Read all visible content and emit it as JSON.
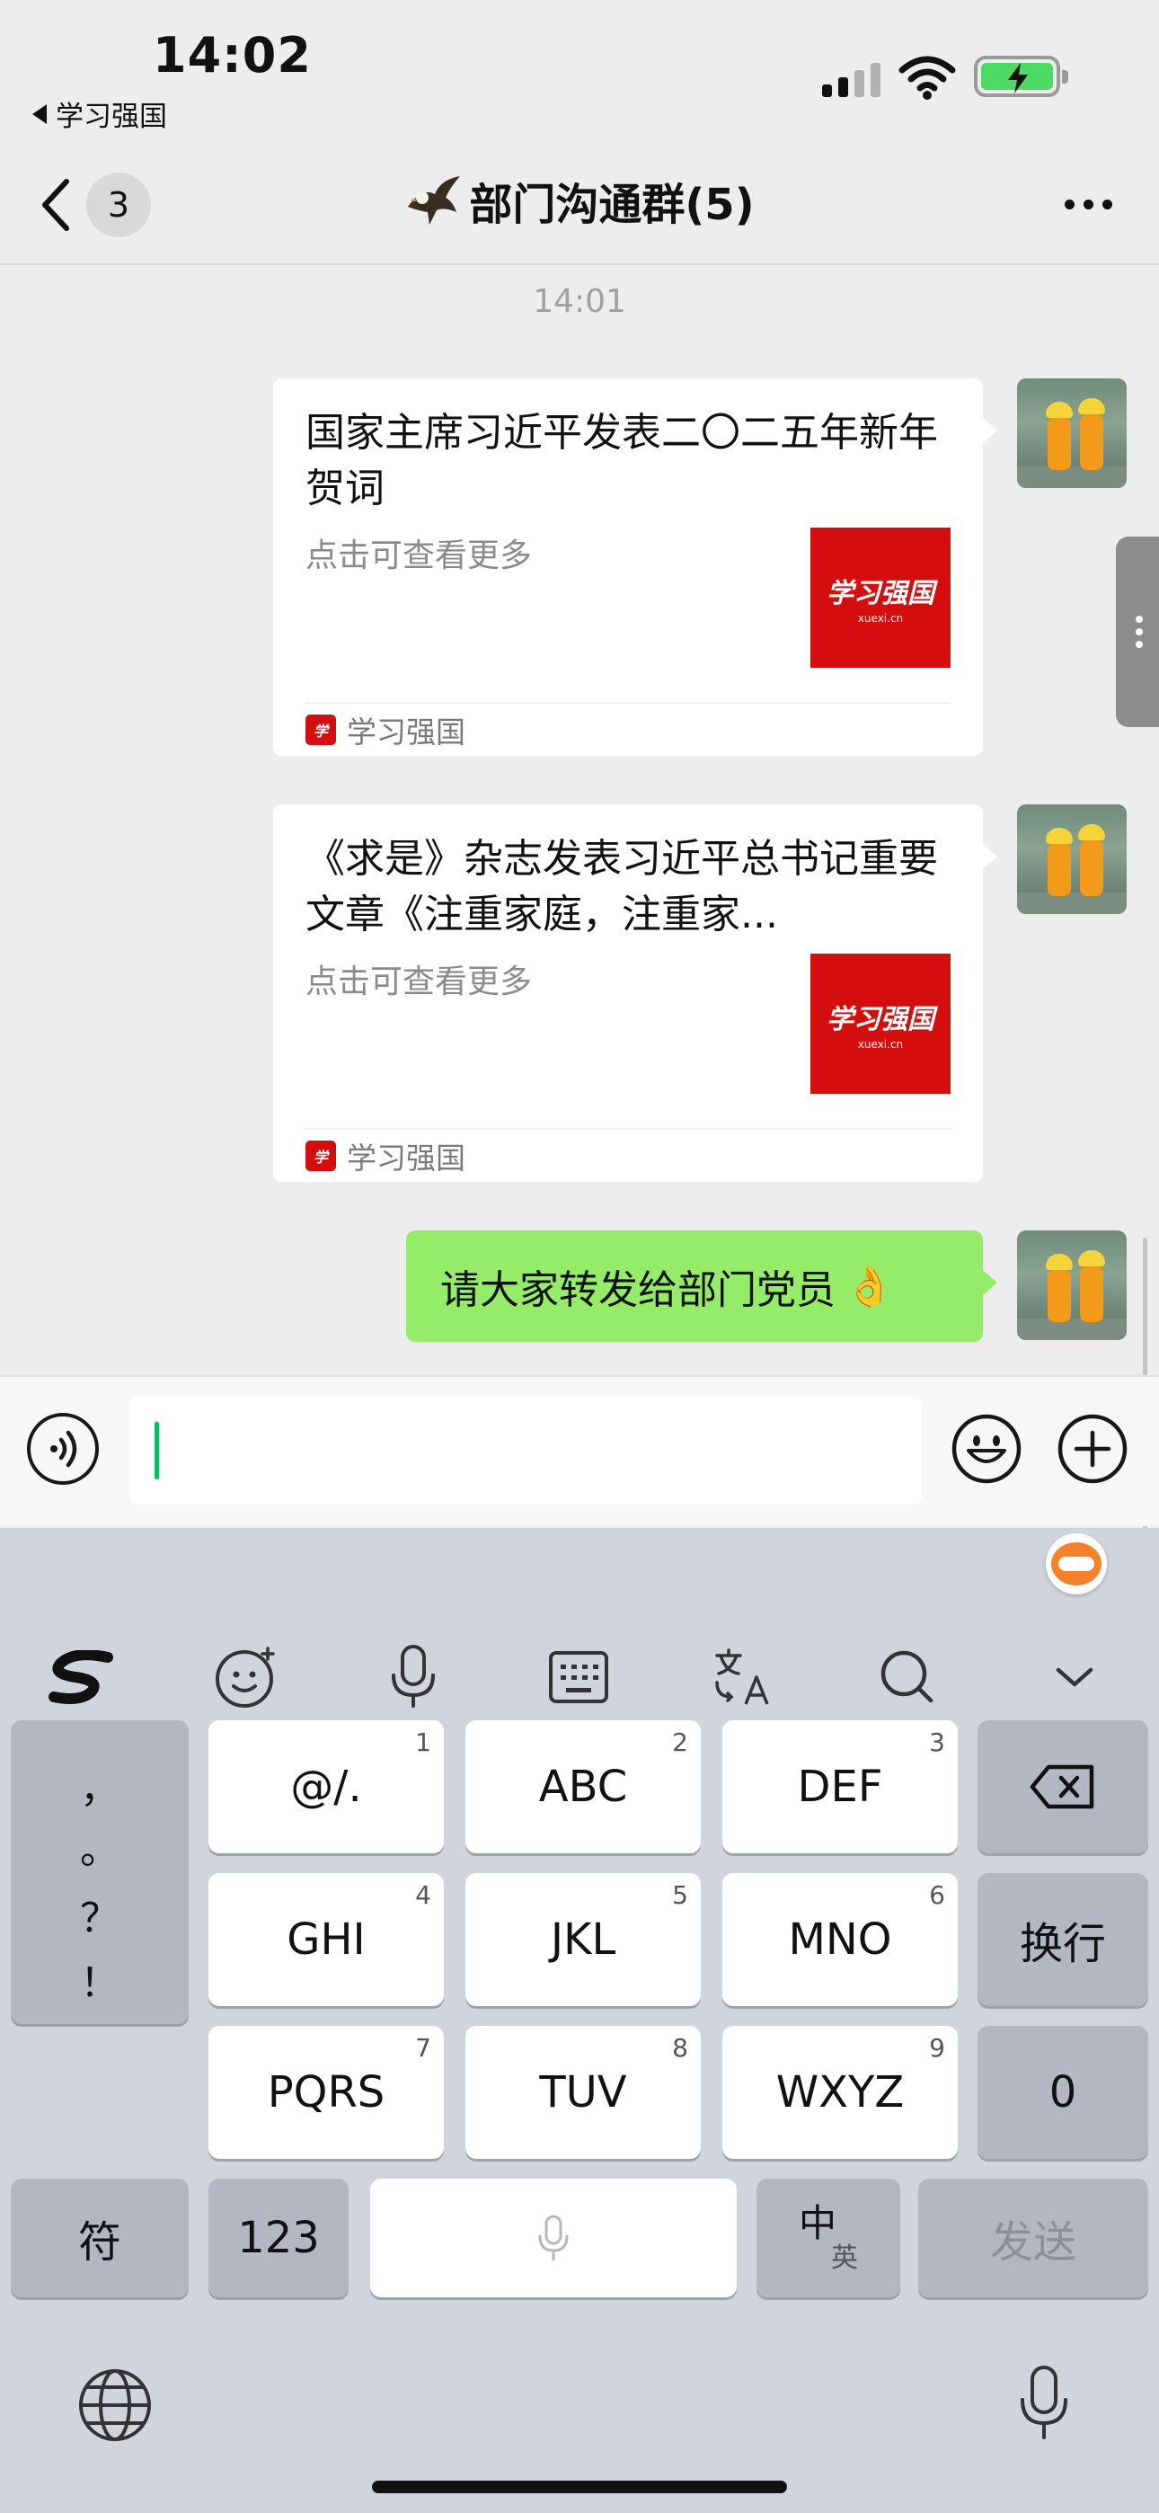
{
  "status_bar": {
    "time": "14:02",
    "back_app": "学习强国"
  },
  "nav": {
    "unread_count": "3",
    "title": "部门沟通群(5)"
  },
  "chat": {
    "timestamp": "14:01",
    "messages": [
      {
        "type": "link_card",
        "title": "国家主席习近平发表二〇二五年新年贺词",
        "description": "点击可查看更多",
        "source": "学习强国",
        "thumb_logo": "学习强国",
        "thumb_sub": "xuexi.cn"
      },
      {
        "type": "link_card",
        "title": "《求是》杂志发表习近平总书记重要文章《注重家庭，注重家...",
        "description": "点击可查看更多",
        "source": "学习强国",
        "thumb_logo": "学习强国",
        "thumb_sub": "xuexi.cn"
      },
      {
        "type": "text",
        "text": "请大家转发给部门党员",
        "emoji": "👌"
      }
    ]
  },
  "input": {
    "value": ""
  },
  "keyboard": {
    "punctuation": [
      "，",
      "。",
      "？",
      "！"
    ],
    "rows": [
      [
        {
          "label": "@/.",
          "num": "1"
        },
        {
          "label": "ABC",
          "num": "2"
        },
        {
          "label": "DEF",
          "num": "3"
        }
      ],
      [
        {
          "label": "GHI",
          "num": "4"
        },
        {
          "label": "JKL",
          "num": "5"
        },
        {
          "label": "MNO",
          "num": "6"
        }
      ],
      [
        {
          "label": "PQRS",
          "num": "7"
        },
        {
          "label": "TUV",
          "num": "8"
        },
        {
          "label": "WXYZ",
          "num": "9"
        }
      ]
    ],
    "newline_label": "换行",
    "zero_label": "0",
    "symbol_label": "符",
    "numeric_label": "123",
    "lang_main": "中",
    "lang_alt": "英",
    "send_label": "发送"
  },
  "colors": {
    "accent_green": "#07c160",
    "bubble_green": "#95ec69",
    "brand_red": "#d40e0e"
  },
  "icons": [
    "back-icon",
    "more-icon",
    "voice-icon",
    "emoji-icon",
    "plus-icon",
    "sogou-logo-icon",
    "emoji-kb-icon",
    "mic-icon",
    "keyboard-icon",
    "translate-icon",
    "search-icon",
    "collapse-icon",
    "backspace-icon",
    "globe-icon",
    "dictation-icon"
  ]
}
